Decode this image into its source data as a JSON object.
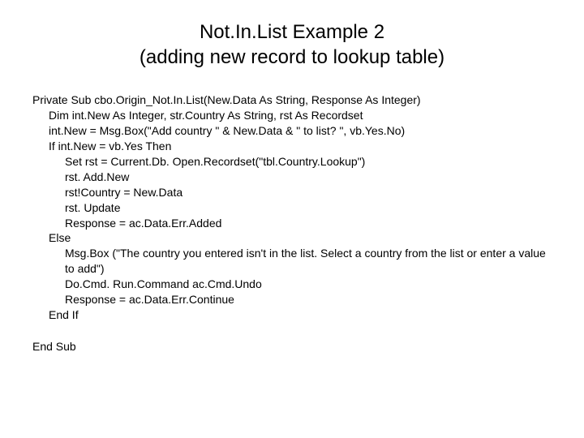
{
  "title_line1": "Not.In.List Example 2",
  "title_line2": "(adding new record to lookup table)",
  "code": {
    "l1": "Private Sub cbo.Origin_Not.In.List(New.Data As String, Response As Integer)",
    "l2": "Dim int.New As Integer, str.Country As String, rst As Recordset",
    "l3": "int.New = Msg.Box(\"Add country \" & New.Data & \" to list? \", vb.Yes.No)",
    "l4": "If int.New = vb.Yes Then",
    "l5": "Set rst = Current.Db. Open.Recordset(\"tbl.Country.Lookup\")",
    "l6": "rst. Add.New",
    "l7": "rst!Country = New.Data",
    "l8": "rst. Update",
    "l9": "Response = ac.Data.Err.Added",
    "l10": "Else",
    "l11": "Msg.Box (\"The country you entered isn't in the list. Select a country from the list or enter a value to add\")",
    "l12": "Do.Cmd. Run.Command ac.Cmd.Undo",
    "l13": "Response = ac.Data.Err.Continue",
    "l14": "End If",
    "l15": "End Sub"
  }
}
